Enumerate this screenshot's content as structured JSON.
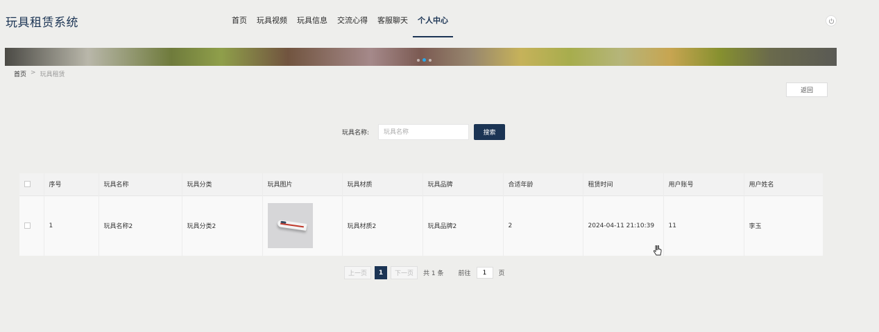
{
  "header": {
    "title": "玩具租赁系统",
    "nav": [
      "首页",
      "玩具视频",
      "玩具信息",
      "交流心得",
      "客服聊天",
      "个人中心"
    ],
    "active_nav_index": 5
  },
  "breadcrumb": {
    "home": "首页",
    "separator": ">",
    "current": "玩具租赁"
  },
  "back_label": "返回",
  "search": {
    "label": "玩具名称:",
    "placeholder": "玩具名称",
    "button": "搜索"
  },
  "table": {
    "headers": [
      "序号",
      "玩具名称",
      "玩具分类",
      "玩具图片",
      "玩具材质",
      "玩具品牌",
      "合适年龄",
      "租赁时间",
      "用户账号",
      "用户姓名"
    ],
    "rows": [
      {
        "index": "1",
        "name": "玩具名称2",
        "category": "玩具分类2",
        "image": "toy-train-image",
        "material": "玩具材质2",
        "brand": "玩具品牌2",
        "age": "2",
        "rent_time": "2024-04-11 21:10:39",
        "account": "11",
        "user_name": "李玉"
      }
    ]
  },
  "pagination": {
    "prev": "上一页",
    "current": "1",
    "next": "下一页",
    "total": "共 1 条",
    "goto": "前往",
    "goto_value": "1",
    "page_suffix": "页"
  },
  "colors": {
    "primary": "#1b3454",
    "dot_active": "#2aa7e8",
    "background": "#eeeeec"
  },
  "icons": {
    "power": "power-icon",
    "cursor": "hand-pointer-icon"
  }
}
